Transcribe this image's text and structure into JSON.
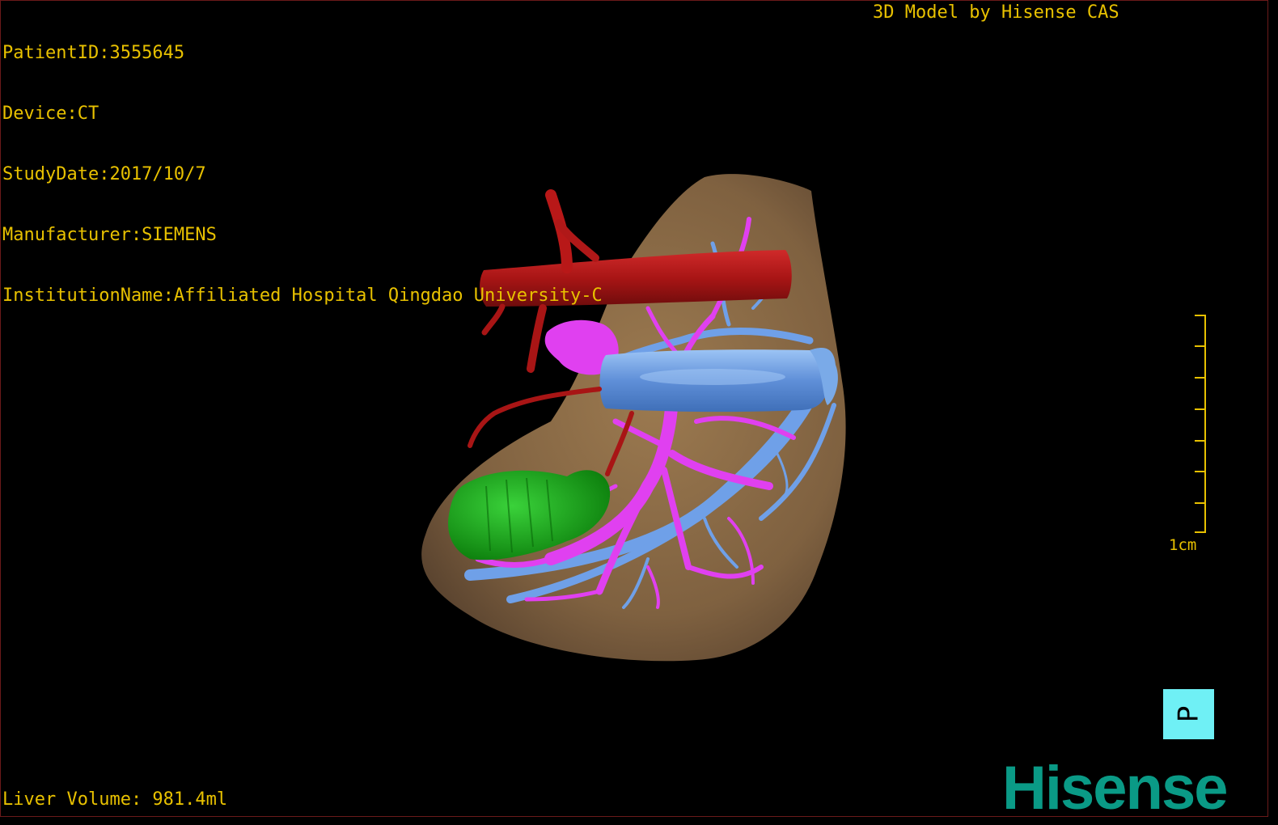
{
  "metadata": {
    "patient_id": "PatientID:3555645",
    "device": "Device:CT",
    "study_date": "StudyDate:2017/10/7",
    "manufacturer": "Manufacturer:SIEMENS",
    "institution": "InstitutionName:Affiliated Hospital Qingdao University-C"
  },
  "model_credit": "3D Model by Hisense CAS",
  "liver_volume": "Liver Volume: 981.4ml",
  "scale_bar": {
    "label": "1cm",
    "ticks": 8
  },
  "orientation_marker": "P",
  "brand": "Hisense",
  "colors": {
    "text": "#e8c100",
    "liver": "#8a6a45",
    "artery": "#b01818",
    "portal_vein": "#e040f0",
    "hepatic_vein": "#6fa0e8",
    "gallbladder": "#1aa81a",
    "orientation_box": "#6ff0f5",
    "brand": "#0a9a86"
  },
  "structures": [
    "liver-surface",
    "aorta",
    "portal-vein",
    "inferior-vena-cava",
    "hepatic-veins",
    "gallbladder"
  ]
}
